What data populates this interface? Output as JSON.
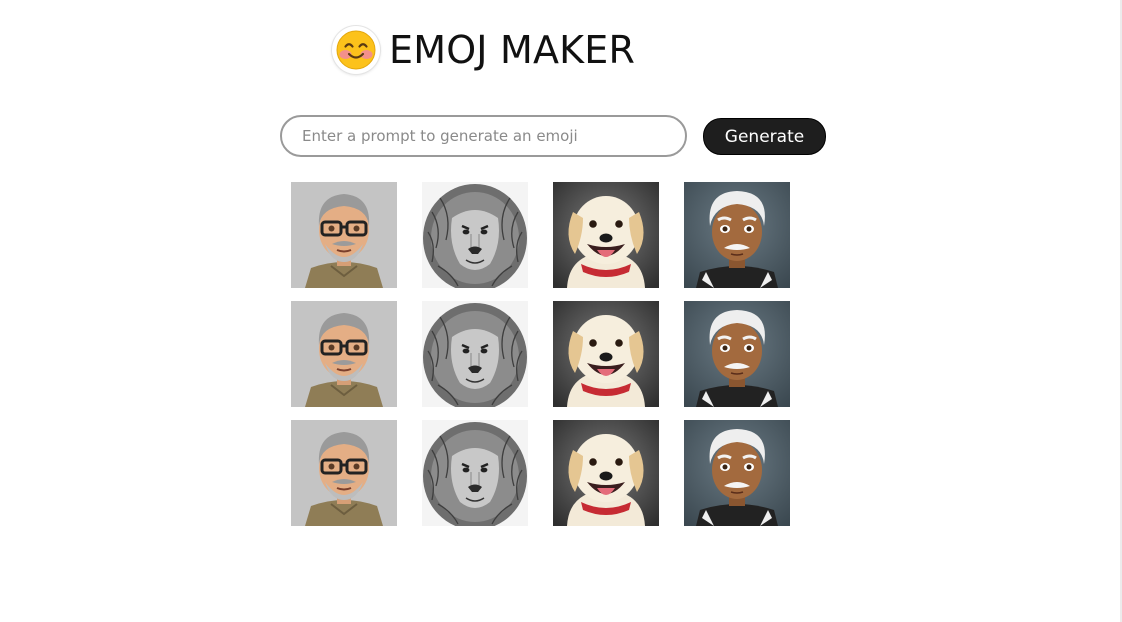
{
  "header": {
    "title": "EMOJ MAKER",
    "logo_icon": "smiling-face-icon"
  },
  "prompt": {
    "placeholder": "Enter a prompt to generate an emoji",
    "value": ""
  },
  "generate": {
    "label": "Generate"
  },
  "gallery": {
    "rows": 3,
    "columns": [
      "old-man-glasses-emoji",
      "lion-sketch",
      "golden-retriever-dog",
      "white-haired-man-emoji"
    ]
  },
  "colors": {
    "button_bg": "#1e1e1e",
    "input_border": "#9a9a9a",
    "accent_blush": "#f28b98"
  }
}
